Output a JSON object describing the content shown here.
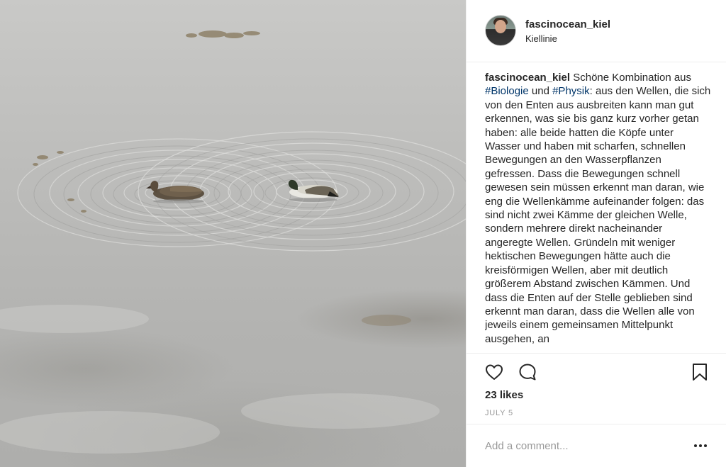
{
  "post": {
    "username": "fascinocean_kiel",
    "location": "Kiellinie",
    "caption": {
      "username": "fascinocean_kiel",
      "part1": " Schöne Kombination aus ",
      "tag1": "#Biologie",
      "part2": " und ",
      "tag2": "#Physik",
      "part3": ": aus den Wellen, die sich von den Enten aus ausbreiten kann man gut erkennen, was sie bis ganz kurz vorher getan haben: alle beide hatten die Köpfe unter Wasser und haben mit scharfen, schnellen Bewegungen an den Wasserpflanzen gefressen. Dass die Bewegungen schnell gewesen sein müssen erkennt man daran, wie eng die Wellenkämme aufeinander folgen: das sind nicht zwei Kämme der gleichen Welle, sondern mehrere direkt nacheinander angeregte Wellen. Gründeln mit weniger hektischen Bewegungen hätte auch die kreisförmigen Wellen, aber mit deutlich größerem Abstand zwischen Kämmen. Und dass die Enten auf der Stelle geblieben sind erkennt man daran, dass die Wellen alle von jeweils einem gemeinsamen Mittelpunkt ausgehen, an"
    },
    "likes": "23 likes",
    "date": "JULY 5"
  },
  "comment": {
    "placeholder": "Add a comment..."
  },
  "icons": {
    "like": "heart-icon",
    "comment": "comment-bubble-icon",
    "save": "bookmark-icon",
    "more": "more-options-icon"
  },
  "colors": {
    "text": "#262626",
    "hashtag": "#003569",
    "muted": "#999999",
    "border": "#efefef"
  }
}
